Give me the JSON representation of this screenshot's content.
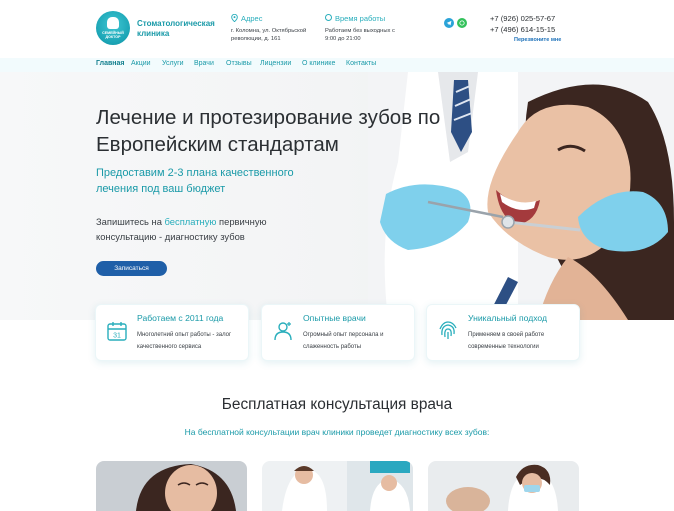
{
  "header": {
    "logo_text": "СЕМЕЙНЫЙ ДОКТОР",
    "clinic_name": "Стоматологическая клиника",
    "address_title": "Адрес",
    "address_text": "г. Коломна, ул. Октябрьской революции, д. 161",
    "hours_title": "Время работы",
    "hours_text": "Работаем без выходных с 9:00 до 21:00",
    "phone_1": "+7 (926) 025-57-67",
    "phone_2": "+7 (496) 614-15-15",
    "callback_label": "Перезвоните мне",
    "messengers": [
      "telegram-icon",
      "whatsapp-icon"
    ]
  },
  "nav": {
    "items": [
      {
        "label": "Главная",
        "active": true
      },
      {
        "label": "Акции"
      },
      {
        "label": "Услуги"
      },
      {
        "label": "Врачи"
      },
      {
        "label": "Отзывы"
      },
      {
        "label": "Лицензии"
      },
      {
        "label": "О клинике"
      },
      {
        "label": "Контакты"
      }
    ]
  },
  "hero": {
    "title": "Лечение и протезирование зубов по Европейским стандартам",
    "subtitle": "Предоставим 2-3 плана качественного лечения под ваш бюджет",
    "lead_before": "Запишитесь на ",
    "lead_highlight": "бесплатную",
    "lead_after": " первичную консультацию - диагностику зубов",
    "cta_label": "Записаться"
  },
  "features": [
    {
      "title": "Работаем с 2011 года",
      "text": "Многолетний опыт работы - залог качественного сервиса",
      "icon": "calendar-icon"
    },
    {
      "title": "Опытные врачи",
      "text": "Огромный опыт персонала и слаженность работы",
      "icon": "doctor-icon"
    },
    {
      "title": "Уникальный подход",
      "text": "Применяем в своей работе современные технологии",
      "icon": "fingerprint-icon"
    }
  ],
  "consultation": {
    "title": "Бесплатная консультация врача",
    "subtitle": "На бесплатной консультации врач клиники проведет диагностику всех зубов:"
  },
  "colors": {
    "accent": "#1a9aa8",
    "button": "#1f5fa8",
    "nav_bg": "#f2fbfd"
  }
}
